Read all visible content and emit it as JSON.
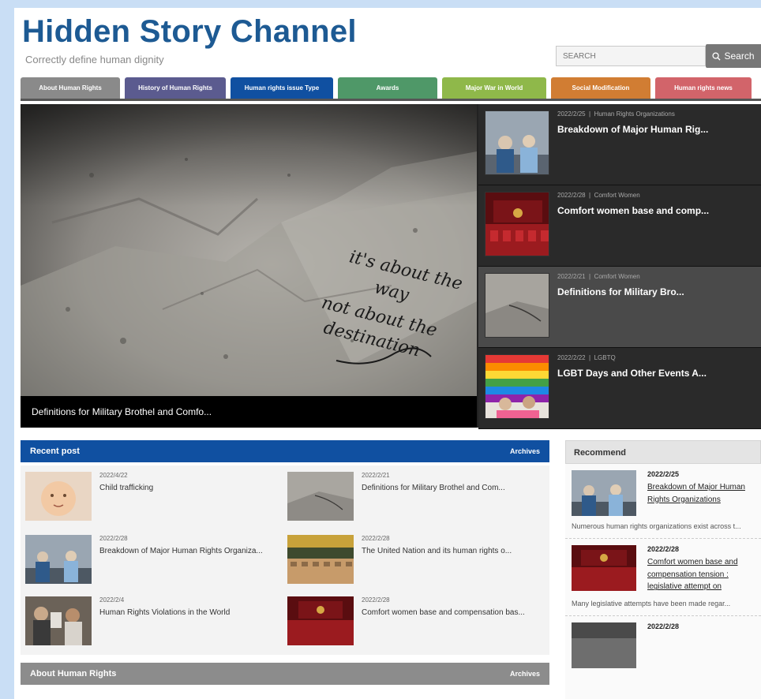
{
  "site": {
    "title": "Hidden Story Channel",
    "tagline": "Correctly define human dignity"
  },
  "search": {
    "placeholder": "SEARCH",
    "button_label": "Search"
  },
  "nav": {
    "tabs": [
      {
        "label": "About Human Rights",
        "color": "#8a8a8a"
      },
      {
        "label": "History of Human Rights",
        "color": "#5b5b8f"
      },
      {
        "label": "Human rights issue Type",
        "color": "#1050a1"
      },
      {
        "label": "Awards",
        "color": "#4f9868"
      },
      {
        "label": "Major War in World",
        "color": "#8fb84a"
      },
      {
        "label": "Social Modification",
        "color": "#d17d33"
      },
      {
        "label": "Human rights news",
        "color": "#d2646a"
      }
    ]
  },
  "hero": {
    "caption": "Definitions for Military Brothel and Comfo...",
    "stone_text": [
      "it's about the",
      "way",
      "not about the",
      "destination"
    ],
    "side_items": [
      {
        "date": "2022/2/25",
        "category": "Human Rights Organizations",
        "title": "Breakdown of Major Human Rig..."
      },
      {
        "date": "2022/2/28",
        "category": "Comfort Women",
        "title": "Comfort women base and comp..."
      },
      {
        "date": "2022/2/21",
        "category": "Comfort Women",
        "title": "Definitions for Military Bro..."
      },
      {
        "date": "2022/2/22",
        "category": "LGBTQ",
        "title": "LGBT Days and Other Events A..."
      }
    ]
  },
  "recent": {
    "heading": "Recent post",
    "archive_label": "Archives",
    "posts": [
      {
        "date": "2022/4/22",
        "title": "Child trafficking"
      },
      {
        "date": "2022/2/21",
        "title": "Definitions for Military Brothel and Com..."
      },
      {
        "date": "2022/2/28",
        "title": "Breakdown of Major Human Rights Organiza..."
      },
      {
        "date": "2022/2/28",
        "title": "The United Nation and its human rights o..."
      },
      {
        "date": "2022/2/4",
        "title": "Human Rights Violations in the World"
      },
      {
        "date": "2022/2/28",
        "title": "Comfort women base and compensation bas..."
      }
    ]
  },
  "about": {
    "heading": "About Human Rights",
    "archive_label": "Archives"
  },
  "recommend": {
    "heading": "Recommend",
    "items": [
      {
        "date": "2022/2/25",
        "title": "Breakdown of Major Human Rights Organizations",
        "excerpt": "Numerous human rights organizations exist across t..."
      },
      {
        "date": "2022/2/28",
        "title": "Comfort women base and compensation tension : legislative attempt on",
        "excerpt": "Many legislative attempts have been made regar..."
      },
      {
        "date": "2022/2/28",
        "title": "",
        "excerpt": ""
      }
    ]
  }
}
